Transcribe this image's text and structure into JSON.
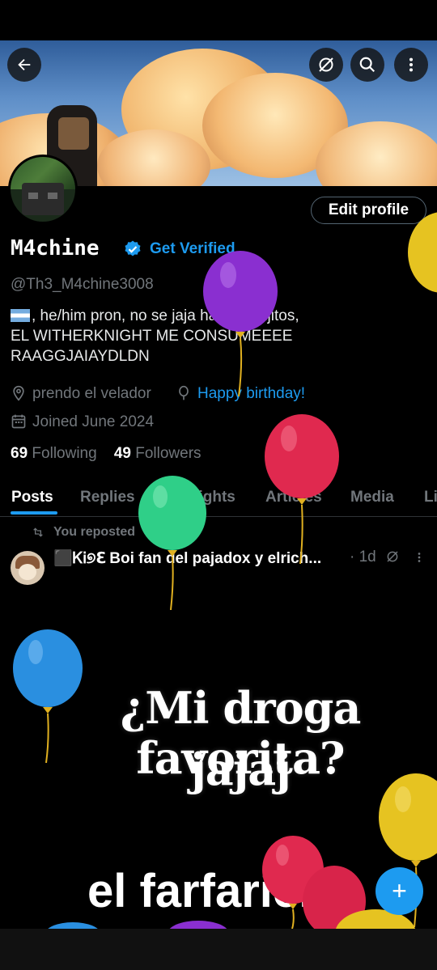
{
  "header": {
    "back_icon": "arrow-left-icon",
    "grok_icon": "grok-icon",
    "search_icon": "search-icon",
    "more_icon": "more-vertical-icon"
  },
  "profile": {
    "edit_label": "Edit profile",
    "display_name": "M4chine",
    "get_verified": "Get Verified",
    "handle": "@Th3_M4chine3008",
    "bio_line1": ", he/him pron, no se jaja hago dibujitos,",
    "bio_line2": "EL WITHERKNIGHT ME CONSUMEEEE",
    "bio_line3": "RAAGGJAIAYDLDN",
    "location": "prendo el velador",
    "birthday": "Happy birthday!",
    "joined": "Joined June 2024",
    "following_count": "69",
    "following_label": "Following",
    "followers_count": "49",
    "followers_label": "Followers"
  },
  "tabs": [
    {
      "label": "Posts"
    },
    {
      "label": "Replies"
    },
    {
      "label": "Highlights"
    },
    {
      "label": "Articles"
    },
    {
      "label": "Media"
    },
    {
      "label": "Li"
    }
  ],
  "post": {
    "repost_label": "You reposted",
    "author": "⬛ᏦᎥ୭ℇ Boi fan del pajadox y elrich...",
    "dot": "·",
    "time": "1d",
    "meme_line1": "¿Mi droga favorita?",
    "meme_line2": "jajaj",
    "meme_line3": "el farfarich"
  },
  "fab_label": "+",
  "colors": {
    "accent": "#1d9bf0",
    "background": "#000000",
    "muted": "#71767b"
  }
}
